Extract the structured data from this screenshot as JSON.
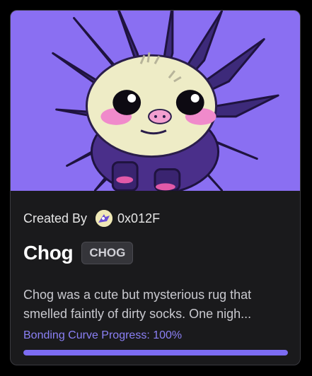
{
  "card": {
    "created_by_label": "Created By",
    "creator_address": "0x012F",
    "token_name": "Chog",
    "ticker": "CHOG",
    "description_line1": "Chog was a cute but mysterious rug that",
    "description_line2": "smelled faintly of dirty socks. One nigh...",
    "progress_label": "Bonding Curve Progress: 100%",
    "progress_fraction": 1.0
  },
  "colors": {
    "hero_bg": "#8a6ff2",
    "card_bg": "#1a1a1c",
    "accent": "#7c6cf2",
    "progress_text": "#8b80f5"
  },
  "icons": {
    "creator_avatar": "creator-avatar-icon",
    "hero_image": "chog-mascot-image"
  }
}
